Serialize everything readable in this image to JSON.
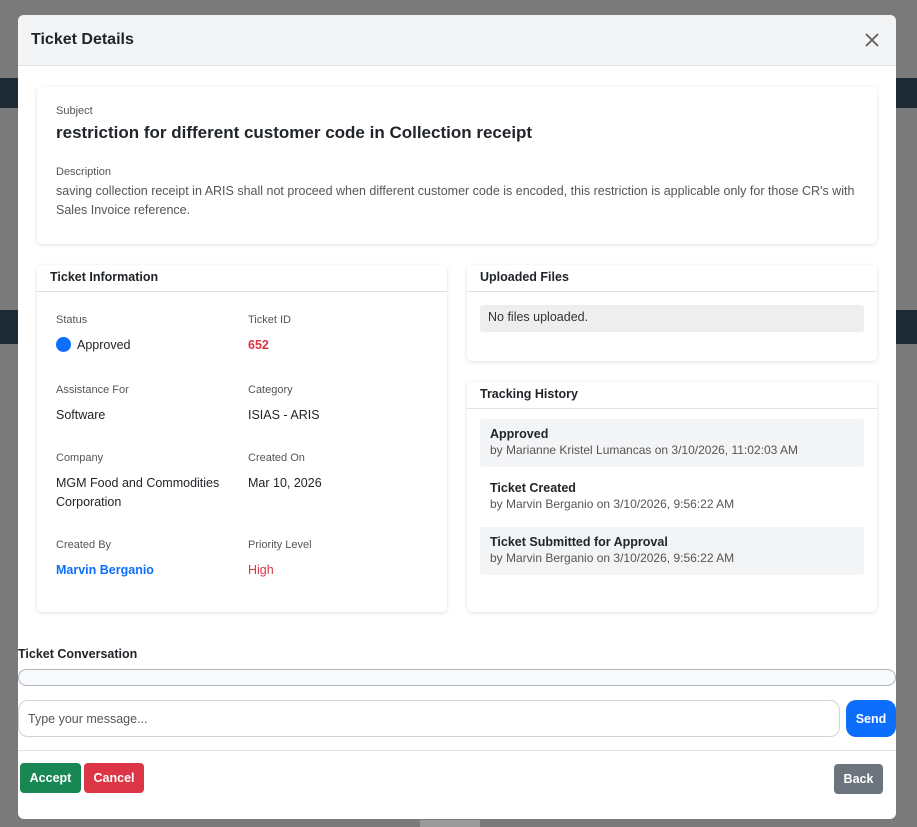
{
  "modal": {
    "title": "Ticket Details"
  },
  "subject": {
    "label": "Subject",
    "value": "restriction for different customer code in Collection receipt",
    "description_label": "Description",
    "description": "saving collection receipt in ARIS shall not proceed when different customer code is encoded, this restriction is applicable only for those CR's with Sales Invoice reference."
  },
  "info": {
    "title": "Ticket Information",
    "status_label": "Status",
    "status_value": "Approved",
    "ticket_id_label": "Ticket ID",
    "ticket_id_value": "652",
    "assistance_label": "Assistance For",
    "assistance_value": "Software",
    "category_label": "Category",
    "category_value": "ISIAS - ARIS",
    "company_label": "Company",
    "company_value": "MGM Food and Commodities Corporation",
    "created_on_label": "Created On",
    "created_on_value": "Mar 10, 2026",
    "created_by_label": "Created By",
    "created_by_value": "Marvin Berganio",
    "priority_label": "Priority Level",
    "priority_value": "High"
  },
  "files": {
    "title": "Uploaded Files",
    "empty_text": "No files uploaded."
  },
  "history": {
    "title": "Tracking History",
    "items": [
      {
        "title": "Approved",
        "detail": "by Marianne Kristel Lumancas on 3/10/2026, 11:02:03 AM"
      },
      {
        "title": "Ticket Created",
        "detail": "by Marvin Berganio on 3/10/2026, 9:56:22 AM"
      },
      {
        "title": "Ticket Submitted for Approval",
        "detail": "by Marvin Berganio on 3/10/2026, 9:56:22 AM"
      }
    ]
  },
  "conversation": {
    "title": "Ticket Conversation",
    "placeholder": "Type your message...",
    "send_label": "Send"
  },
  "footer": {
    "accept_label": "Accept",
    "cancel_label": "Cancel",
    "back_label": "Back"
  },
  "colors": {
    "primary": "#0d6efd",
    "success": "#198754",
    "danger": "#dc3545",
    "secondary": "#6c757d"
  }
}
